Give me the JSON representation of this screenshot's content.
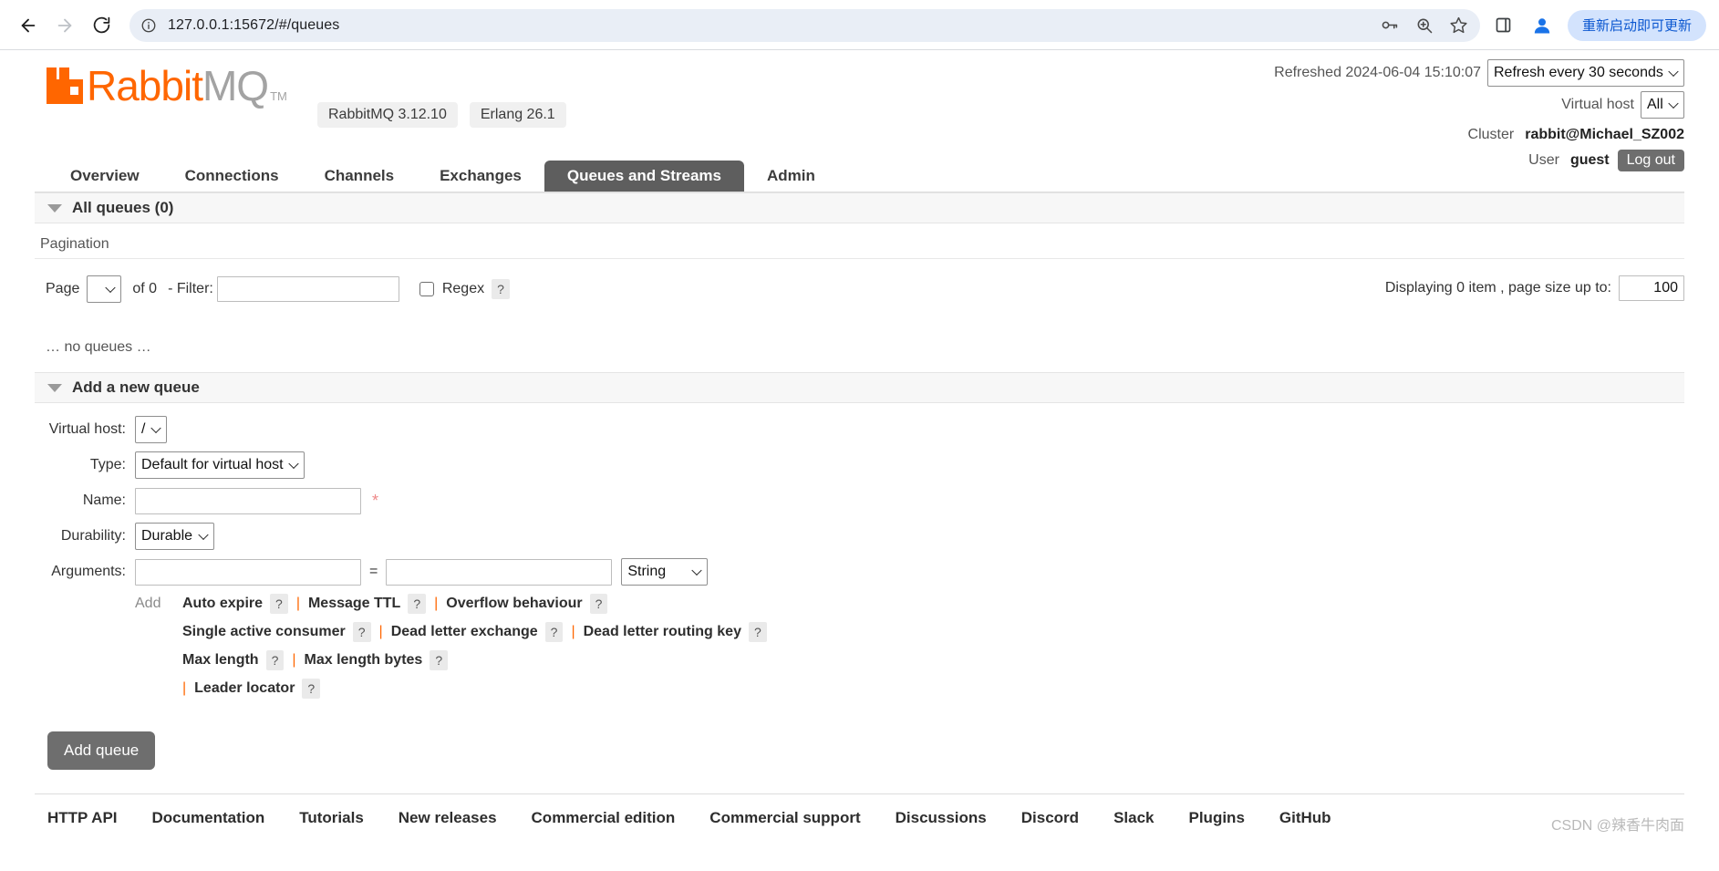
{
  "browser": {
    "back_icon": "back-arrow-icon",
    "forward_icon": "forward-arrow-icon",
    "reload_icon": "reload-icon",
    "url": "127.0.0.1:15672/#/queues",
    "site_info_icon": "site-info-icon",
    "password_icon": "password-key-icon",
    "zoom_icon": "zoom-magnifier-icon",
    "bookmark_icon": "bookmark-star-icon",
    "sidepanel_icon": "side-panel-icon",
    "profile_icon": "profile-avatar-icon",
    "update_button": "重新启动即可更新"
  },
  "header": {
    "logo_rabbit": "Rabbit",
    "logo_mq": "MQ",
    "logo_tm": "TM",
    "version_badges": [
      "RabbitMQ 3.12.10",
      "Erlang 26.1"
    ],
    "refreshed_label": "Refreshed 2024-06-04 15:10:07",
    "refresh_select": "Refresh every 30 seconds",
    "vhost_label": "Virtual host",
    "vhost_select": "All",
    "cluster_label": "Cluster",
    "cluster_name": "rabbit@Michael_SZ002",
    "user_label": "User",
    "user_name": "guest",
    "logout_label": "Log out"
  },
  "tabs": [
    {
      "label": "Overview",
      "active": false
    },
    {
      "label": "Connections",
      "active": false
    },
    {
      "label": "Channels",
      "active": false
    },
    {
      "label": "Exchanges",
      "active": false
    },
    {
      "label": "Queues and Streams",
      "active": true
    },
    {
      "label": "Admin",
      "active": false
    }
  ],
  "queues_section": {
    "title": "All queues (0)",
    "pagination_label": "Pagination",
    "page_label": "Page",
    "page_value": "",
    "of_label": "of 0",
    "filter_label": "- Filter:",
    "filter_value": "",
    "regex_label": "Regex",
    "regex_help": "?",
    "displaying_text": "Displaying 0 item , page size up to:",
    "page_size": "100",
    "empty_text": "… no queues …"
  },
  "add_queue": {
    "title": "Add a new queue",
    "vhost_label": "Virtual host:",
    "vhost_value": "/",
    "type_label": "Type:",
    "type_value": "Default for virtual host",
    "name_label": "Name:",
    "name_value": "",
    "required_star": "*",
    "durability_label": "Durability:",
    "durability_value": "Durable",
    "arguments_label": "Arguments:",
    "arg_key": "",
    "arg_value": "",
    "equals": "=",
    "arg_type": "String",
    "add_label": "Add",
    "preset_lines": [
      [
        {
          "label": "Auto expire",
          "help": "?"
        },
        {
          "label": "Message TTL",
          "help": "?"
        },
        {
          "label": "Overflow behaviour",
          "help": "?"
        }
      ],
      [
        {
          "label": "Single active consumer",
          "help": "?"
        },
        {
          "label": "Dead letter exchange",
          "help": "?"
        },
        {
          "label": "Dead letter routing key",
          "help": "?"
        }
      ],
      [
        {
          "label": "Max length",
          "help": "?"
        },
        {
          "label": "Max length bytes",
          "help": "?"
        }
      ],
      [
        {
          "label": "Leader locator",
          "help": "?"
        }
      ]
    ],
    "submit_label": "Add queue"
  },
  "footer": {
    "links": [
      "HTTP API",
      "Documentation",
      "Tutorials",
      "New releases",
      "Commercial edition",
      "Commercial support",
      "Discussions",
      "Discord",
      "Slack",
      "Plugins",
      "GitHub"
    ],
    "watermark": "CSDN @辣香牛肉面"
  },
  "colors": {
    "brand_orange": "#ff6600",
    "active_tab": "#5e5e5e",
    "button_grey": "#6e6e6e",
    "update_blue": "#0b57d0"
  }
}
